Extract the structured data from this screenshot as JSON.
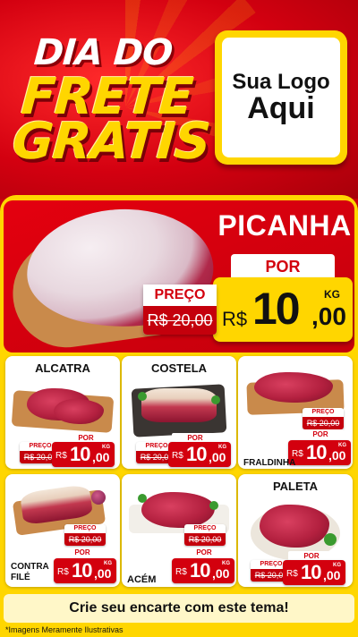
{
  "header": {
    "line1": "DIA DO",
    "line2": "FRETE",
    "line3": "GRATIS",
    "logo_line1": "Sua Logo",
    "logo_line2": "Aqui"
  },
  "hero": {
    "name": "PICANHA",
    "preco_label": "PREÇO",
    "old_price": "R$ 20,00",
    "por_label": "POR",
    "currency": "R$",
    "price_int": "10",
    "price_cents": ",00",
    "unit": "KG"
  },
  "products": [
    {
      "name": "ALCATRA",
      "preco_label": "PREÇO",
      "old_price": "R$ 20,00",
      "por_label": "POR",
      "currency": "R$",
      "price_int": "10",
      "price_cents": ",00",
      "unit": "KG"
    },
    {
      "name": "COSTELA",
      "preco_label": "PREÇO",
      "old_price": "R$ 20,00",
      "por_label": "POR",
      "currency": "R$",
      "price_int": "10",
      "price_cents": ",00",
      "unit": "KG"
    },
    {
      "name": "FRALDINHA",
      "preco_label": "PREÇO",
      "old_price": "R$ 20,00",
      "por_label": "POR",
      "currency": "R$",
      "price_int": "10",
      "price_cents": ",00",
      "unit": "KG"
    },
    {
      "name_line1": "CONTRA",
      "name_line2": "FILÉ",
      "preco_label": "PREÇO",
      "old_price": "R$ 20,00",
      "por_label": "POR",
      "currency": "R$",
      "price_int": "10",
      "price_cents": ",00",
      "unit": "KG"
    },
    {
      "name": "ACÉM",
      "preco_label": "PREÇO",
      "old_price": "R$ 20,00",
      "por_label": "POR",
      "currency": "R$",
      "price_int": "10",
      "price_cents": ",00",
      "unit": "KG"
    },
    {
      "name": "PALETA",
      "preco_label": "PREÇO",
      "old_price": "R$ 20,00",
      "por_label": "POR",
      "currency": "R$",
      "price_int": "10",
      "price_cents": ",00",
      "unit": "KG"
    }
  ],
  "footer": {
    "cta": "Crie seu encarte com este tema!",
    "disclaimer": "*Imagens Meramente Ilustrativas"
  },
  "colors": {
    "brand_red": "#d3000e",
    "brand_yellow": "#ffd600"
  }
}
